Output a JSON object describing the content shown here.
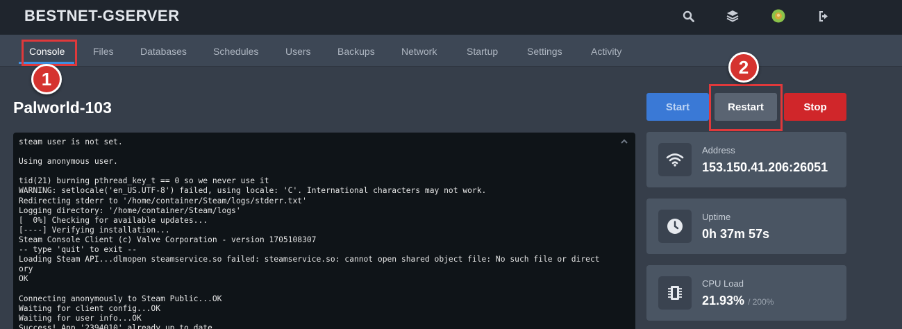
{
  "app": {
    "title": "BESTNET-GSERVER"
  },
  "topbar": {
    "icons": [
      "search-icon",
      "layers-icon",
      "avatar",
      "logout-icon"
    ],
    "avatar_color": "#8bc34a"
  },
  "nav": {
    "tabs": [
      {
        "label": "Console",
        "active": true
      },
      {
        "label": "Files"
      },
      {
        "label": "Databases"
      },
      {
        "label": "Schedules"
      },
      {
        "label": "Users"
      },
      {
        "label": "Backups"
      },
      {
        "label": "Network"
      },
      {
        "label": "Startup"
      },
      {
        "label": "Settings"
      },
      {
        "label": "Activity"
      }
    ]
  },
  "annotations": {
    "step1": "1",
    "step2": "2",
    "highlight_color": "#e0393b"
  },
  "server": {
    "name": "Palworld-103"
  },
  "controls": {
    "start": "Start",
    "restart": "Restart",
    "stop": "Stop"
  },
  "console": {
    "lines": [
      "steam user is not set.",
      "",
      "Using anonymous user.",
      "",
      "tid(21) burning pthread_key_t == 0 so we never use it",
      "WARNING: setlocale('en_US.UTF-8') failed, using locale: 'C'. International characters may not work.",
      "Redirecting stderr to '/home/container/Steam/logs/stderr.txt'",
      "Logging directory: '/home/container/Steam/logs'",
      "[  0%] Checking for available updates...",
      "[----] Verifying installation...",
      "Steam Console Client (c) Valve Corporation - version 1705108307",
      "-- type 'quit' to exit --",
      "Loading Steam API...dlmopen steamservice.so failed: steamservice.so: cannot open shared object file: No such file or direct",
      "ory",
      "OK",
      "",
      "Connecting anonymously to Steam Public...OK",
      "Waiting for client config...OK",
      "Waiting for user info...OK",
      "Success! App '2394010' already up to date."
    ]
  },
  "stats": {
    "address": {
      "label": "Address",
      "value": "153.150.41.206:26051"
    },
    "uptime": {
      "label": "Uptime",
      "value": "0h 37m 57s"
    },
    "cpu": {
      "label": "CPU Load",
      "value": "21.93%",
      "limit": "/ 200%"
    }
  }
}
